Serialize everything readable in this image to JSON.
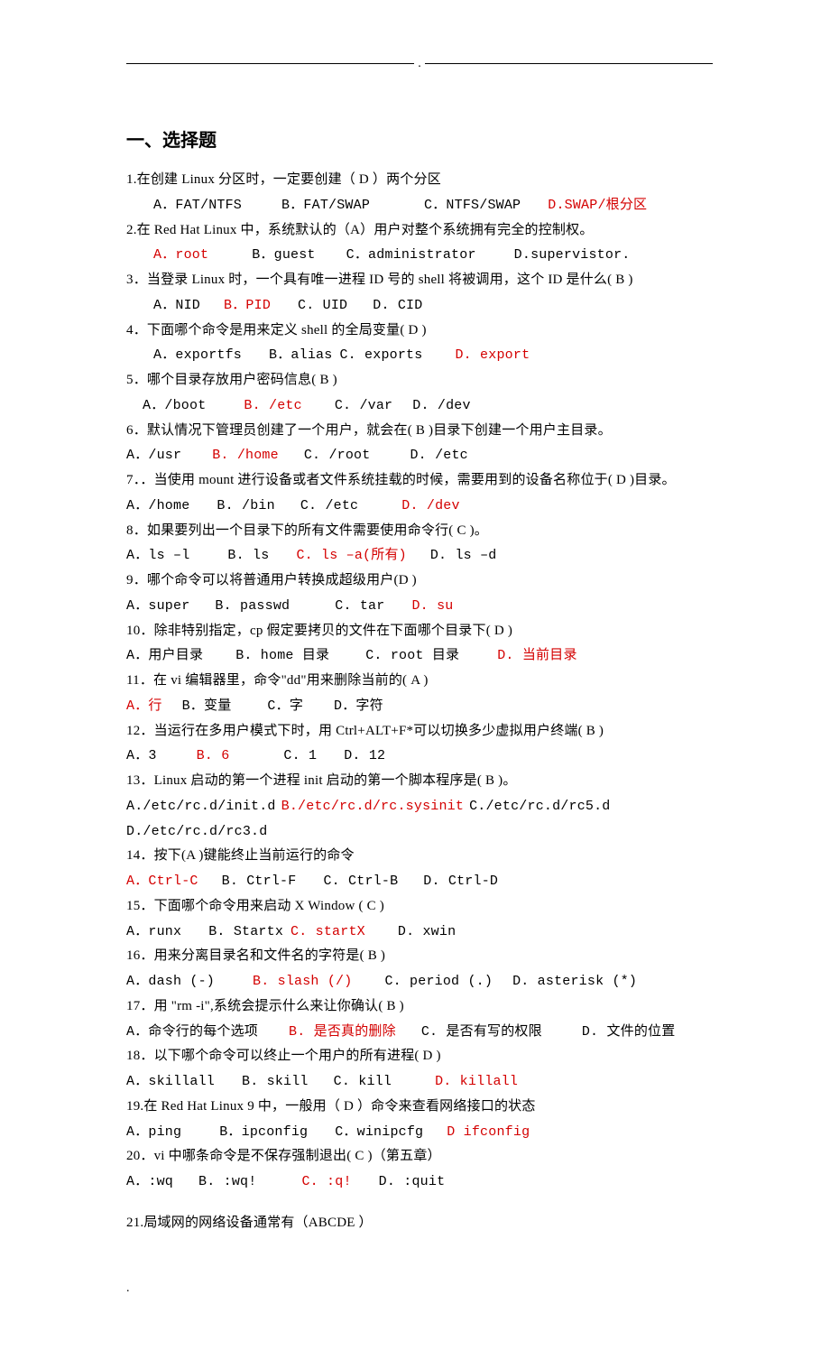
{
  "header_mark": ".",
  "section_title": "一、选择题",
  "questions": [
    {
      "stem": "1.在创建 Linux 分区时，一定要创建（ D ）两个分区",
      "opts": [
        {
          "t": "A．FAT/NTFS"
        },
        {
          "t": "B．FAT/SWAP"
        },
        {
          "t": "C．NTFS/SWAP"
        },
        {
          "t": "D.SWAP/根分区",
          "r": 1
        }
      ],
      "opt_indent": "indent1"
    },
    {
      "stem": "2.在 Red Hat Linux 中，系统默认的（A）用户对整个系统拥有完全的控制权。",
      "opts": [
        {
          "t": "A．root",
          "r": 1
        },
        {
          "t": "B．guest"
        },
        {
          "t": "C．administrator"
        },
        {
          "t": "D.supervistor."
        }
      ],
      "opt_indent": "indent1"
    },
    {
      "stem": "3．当登录 Linux 时，一个具有唯一进程 ID 号的 shell 将被调用，这个 ID 是什么( B  )",
      "opts": [
        {
          "t": "A．NID"
        },
        {
          "t": "B．PID",
          "r": 1
        },
        {
          "t": "C. UID"
        },
        {
          "t": "D. CID"
        }
      ],
      "opt_indent": "indent1"
    },
    {
      "stem": "4．下面哪个命令是用来定义 shell 的全局变量(  D  )",
      "opts": [
        {
          "t": "A．exportfs"
        },
        {
          "t": "B．alias"
        },
        {
          "t": "C. exports"
        },
        {
          "t": "D. export",
          "r": 1
        }
      ],
      "opt_indent": "indent1"
    },
    {
      "stem": "5．哪个目录存放用户密码信息( B  )",
      "opts": [
        {
          "t": "A．/boot"
        },
        {
          "t": "B. /etc",
          "r": 1
        },
        {
          "t": "C. /var"
        },
        {
          "t": "D. /dev"
        }
      ],
      "opt_indent": "indent2"
    },
    {
      "stem": "6．默认情况下管理员创建了一个用户，就会在( B  )目录下创建一个用户主目录。",
      "opts": [
        {
          "t": "A．/usr"
        },
        {
          "t": "B. /home",
          "r": 1
        },
        {
          "t": "C. /root"
        },
        {
          "t": "D. /etc"
        }
      ]
    },
    {
      "stem": "7．．当使用 mount 进行设备或者文件系统挂载的时候，需要用到的设备名称位于( D )目录。",
      "opts": [
        {
          "t": "A．/home"
        },
        {
          "t": "B. /bin"
        },
        {
          "t": "C. /etc"
        },
        {
          "t": "D. /dev",
          "r": 1
        }
      ]
    },
    {
      "stem": "8．如果要列出一个目录下的所有文件需要使用命令行( C   )。",
      "opts": [
        {
          "t": "A．ls –l"
        },
        {
          "t": "B. ls"
        },
        {
          "t": "C. ls –a(所有)",
          "r": 1
        },
        {
          "t": "D. ls –d"
        }
      ]
    },
    {
      "stem": "9．哪个命令可以将普通用户转换成超级用户(D  )",
      "opts": [
        {
          "t": "A．super"
        },
        {
          "t": "B. passwd"
        },
        {
          "t": "C. tar"
        },
        {
          "t": "D. su",
          "r": 1
        }
      ]
    },
    {
      "stem": "10．除非特别指定，cp 假定要拷贝的文件在下面哪个目录下( D  )",
      "opts": [
        {
          "t": "A．用户目录"
        },
        {
          "t": "B. home 目录"
        },
        {
          "t": "C. root 目录"
        },
        {
          "t": "D. 当前目录",
          "r": 1
        }
      ]
    },
    {
      "stem": "11．在 vi 编辑器里，命令\"dd\"用来删除当前的( A )",
      "opts": [
        {
          "t": "A．行",
          "r": 1
        },
        {
          "t": "B．变量"
        },
        {
          "t": "C．字"
        },
        {
          "t": "D．字符"
        }
      ]
    },
    {
      "stem": "12．当运行在多用户模式下时，用 Ctrl+ALT+F*可以切换多少虚拟用户终端( B  )",
      "opts": [
        {
          "t": "A．3"
        },
        {
          "t": "B. 6",
          "r": 1
        },
        {
          "t": "C. 1"
        },
        {
          "t": "D. 12"
        }
      ]
    },
    {
      "stem": "13．Linux 启动的第一个进程 init 启动的第一个脚本程序是( B  )。",
      "opts": [
        {
          "t": "A./etc/rc.d/init.d"
        },
        {
          "t": "B./etc/rc.d/rc.sysinit",
          "r": 1
        },
        {
          "t": "C./etc/rc.d/rc5.d"
        },
        {
          "t": "D./etc/rc.d/rc3.d"
        }
      ],
      "tight": 1
    },
    {
      "stem": "14．按下(A    )键能终止当前运行的命令",
      "opts": [
        {
          "t": "A．Ctrl-C",
          "r": 1
        },
        {
          "t": "B. Ctrl-F"
        },
        {
          "t": "C. Ctrl-B"
        },
        {
          "t": "D. Ctrl-D"
        }
      ]
    },
    {
      "stem": "15．下面哪个命令用来启动 X Window ( C  )",
      "opts": [
        {
          "t": "A．runx"
        },
        {
          "t": "B. Startx"
        },
        {
          "t": "C. startX",
          "r": 1
        },
        {
          "t": "D. xwin"
        }
      ]
    },
    {
      "stem": "16．用来分离目录名和文件名的字符是( B  )",
      "opts": [
        {
          "t": "A．dash (-)"
        },
        {
          "t": "B. slash (/)",
          "r": 1
        },
        {
          "t": "C. period (.)"
        },
        {
          "t": "D. asterisk (*)"
        }
      ]
    },
    {
      "stem": "17．用 \"rm -i\",系统会提示什么来让你确认(  B  )",
      "opts": [
        {
          "t": "A．命令行的每个选项"
        },
        {
          "t": "B. 是否真的删除",
          "r": 1
        },
        {
          "t": "C. 是否有写的权限"
        },
        {
          "t": "D. 文件的位置"
        }
      ]
    },
    {
      "stem": "18．以下哪个命令可以终止一个用户的所有进程( D  )",
      "opts": [
        {
          "t": "A．skillall"
        },
        {
          "t": "B. skill"
        },
        {
          "t": "C. kill"
        },
        {
          "t": "D. killall",
          "r": 1
        }
      ]
    },
    {
      "stem": "19.在 Red Hat Linux 9 中，一般用（ D  ）命令来查看网络接口的状态",
      "opts": [
        {
          "t": "A．ping"
        },
        {
          "t": "B．ipconfig"
        },
        {
          "t": "C．winipcfg"
        },
        {
          "t": "D  ifconfig",
          "r": 1
        }
      ]
    },
    {
      "stem": "20．vi 中哪条命令是不保存强制退出( C  )（第五章）",
      "opts": [
        {
          "t": "A．:wq"
        },
        {
          "t": "B. :wq!"
        },
        {
          "t": "C. :q!",
          "r": 1
        },
        {
          "t": "D. :quit"
        }
      ]
    }
  ],
  "q21": "21.局域网的网络设备通常有（ABCDE      ）",
  "footer_mark": "."
}
